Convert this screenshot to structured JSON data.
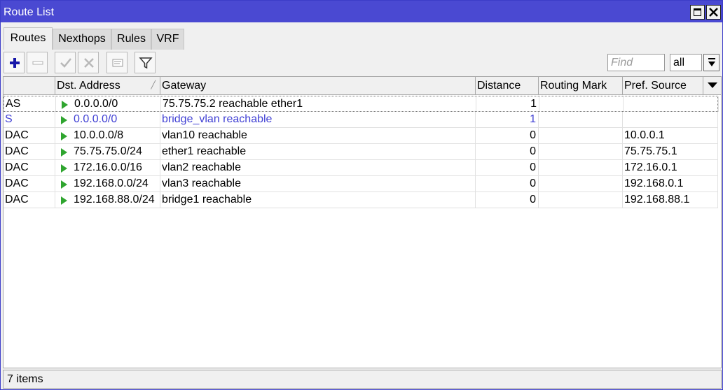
{
  "window": {
    "title": "Route List"
  },
  "tabs": [
    {
      "label": "Routes",
      "active": true
    },
    {
      "label": "Nexthops",
      "active": false
    },
    {
      "label": "Rules",
      "active": false
    },
    {
      "label": "VRF",
      "active": false
    }
  ],
  "toolbar": {
    "buttons": [
      "add-icon",
      "remove-icon",
      "enable-check-icon",
      "disable-x-icon",
      "comment-icon",
      "filter-icon"
    ],
    "find_placeholder": "Find",
    "filter_value": "all"
  },
  "table": {
    "columns": [
      "",
      "Dst. Address",
      "Gateway",
      "Distance",
      "Routing Mark",
      "Pref. Source"
    ],
    "rows": [
      {
        "flags": "AS",
        "dst": "0.0.0.0/0",
        "gateway": "75.75.75.2 reachable ether1",
        "distance": "1",
        "routing_mark": "",
        "pref_source": ""
      },
      {
        "flags": "S",
        "dst": "0.0.0.0/0",
        "gateway": "bridge_vlan reachable",
        "distance": "1",
        "routing_mark": "",
        "pref_source": ""
      },
      {
        "flags": "DAC",
        "dst": "10.0.0.0/8",
        "gateway": "vlan10 reachable",
        "distance": "0",
        "routing_mark": "",
        "pref_source": "10.0.0.1"
      },
      {
        "flags": "DAC",
        "dst": "75.75.75.0/24",
        "gateway": "ether1 reachable",
        "distance": "0",
        "routing_mark": "",
        "pref_source": "75.75.75.1"
      },
      {
        "flags": "DAC",
        "dst": "172.16.0.0/16",
        "gateway": "vlan2 reachable",
        "distance": "0",
        "routing_mark": "",
        "pref_source": "172.16.0.1"
      },
      {
        "flags": "DAC",
        "dst": "192.168.0.0/24",
        "gateway": "vlan3 reachable",
        "distance": "0",
        "routing_mark": "",
        "pref_source": "192.168.0.1"
      },
      {
        "flags": "DAC",
        "dst": "192.168.88.0/24",
        "gateway": "bridge1 reachable",
        "distance": "0",
        "routing_mark": "",
        "pref_source": "192.168.88.1"
      }
    ]
  },
  "status": {
    "text": "7 items"
  },
  "colors": {
    "titlebar": "#4a49d2",
    "inactive_row_text": "#4141d4",
    "active_arrow": "#2fa52f"
  }
}
